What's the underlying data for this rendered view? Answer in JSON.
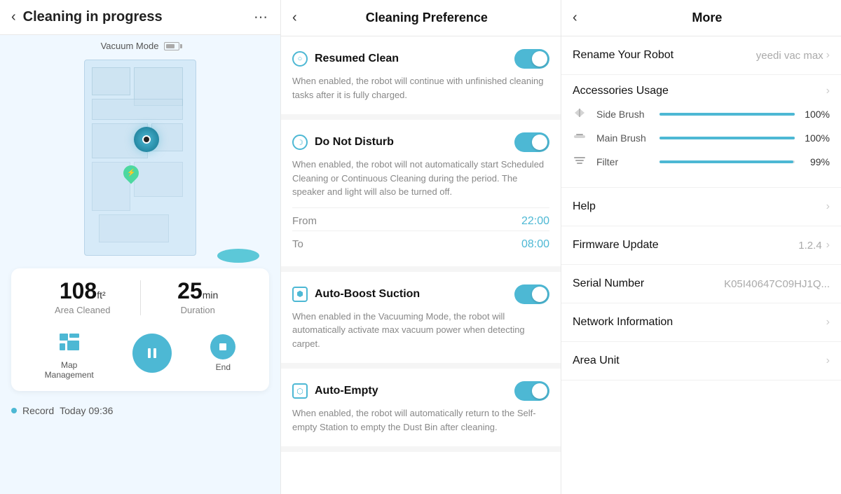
{
  "panel_left": {
    "title": "Cleaning in progress",
    "vacuum_mode": "Vacuum Mode",
    "stat_area_value": "108",
    "stat_area_unit": "ft²",
    "stat_area_label": "Area Cleaned",
    "stat_duration_value": "25",
    "stat_duration_unit": "min",
    "stat_duration_label": "Duration",
    "ctrl_map_label": "Map\nManagement",
    "ctrl_pause_label": "",
    "ctrl_end_label": "End",
    "record_label": "Record",
    "record_time": "Today 09:36"
  },
  "panel_mid": {
    "title": "Cleaning Preference",
    "sections": [
      {
        "id": "resumed-clean",
        "icon_type": "circle",
        "name": "Resumed Clean",
        "description": "When enabled, the robot will continue with unfinished cleaning tasks after it is fully charged.",
        "toggle": true,
        "sub_items": []
      },
      {
        "id": "do-not-disturb",
        "icon_type": "moon",
        "name": "Do Not Disturb",
        "description": "When enabled, the robot will not automatically start Scheduled Cleaning or Continuous Cleaning during the period. The speaker and light will also be turned off.",
        "toggle": true,
        "sub_items": [
          {
            "label": "From",
            "value": "22:00"
          },
          {
            "label": "To",
            "value": "08:00"
          }
        ]
      },
      {
        "id": "auto-boost",
        "icon_type": "square",
        "name": "Auto-Boost Suction",
        "description": "When enabled in the Vacuuming Mode, the robot will automatically activate max vacuum power when detecting carpet.",
        "toggle": true,
        "sub_items": []
      },
      {
        "id": "auto-empty",
        "icon_type": "square",
        "name": "Auto-Empty",
        "description": "When enabled, the robot will automatically return to the Self-empty Station to empty the Dust Bin after cleaning.",
        "toggle": true,
        "sub_items": []
      }
    ]
  },
  "panel_right": {
    "title": "More",
    "rename_label": "Rename Your Robot",
    "rename_value": "yeedi vac max",
    "accessories_label": "Accessories Usage",
    "accessories": [
      {
        "name": "Side Brush",
        "pct": 100,
        "pct_label": "100%"
      },
      {
        "name": "Main Brush",
        "pct": 100,
        "pct_label": "100%"
      },
      {
        "name": "Filter",
        "pct": 99,
        "pct_label": "99%"
      }
    ],
    "items": [
      {
        "label": "Help",
        "value": "",
        "chevron": true
      },
      {
        "label": "Firmware Update",
        "value": "1.2.4",
        "chevron": true
      },
      {
        "label": "Serial Number",
        "value": "K05I40647C09HJ1Q...",
        "chevron": false
      },
      {
        "label": "Network Information",
        "value": "",
        "chevron": true
      },
      {
        "label": "Area Unit",
        "value": "",
        "chevron": true
      }
    ]
  }
}
